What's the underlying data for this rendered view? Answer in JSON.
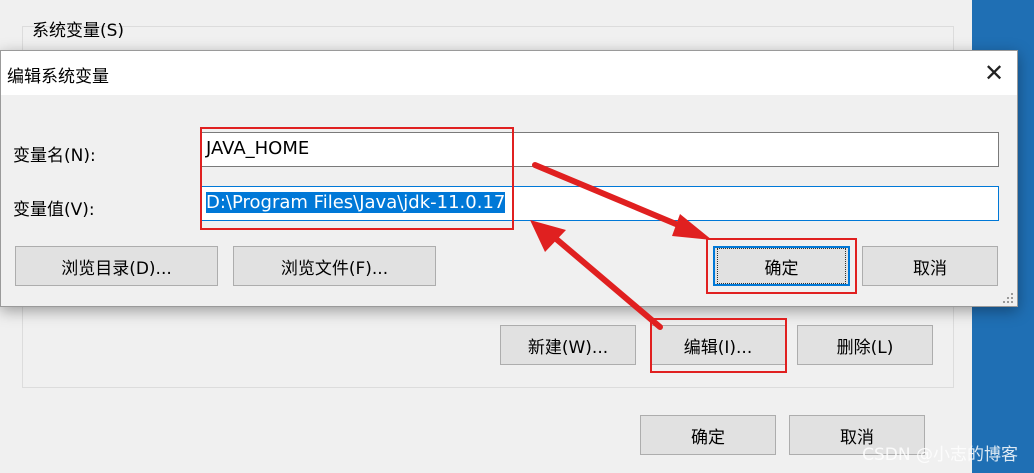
{
  "background_window": {
    "group_label": "系统变量(S)",
    "buttons": {
      "new": "新建(W)...",
      "edit": "编辑(I)...",
      "delete": "删除(L)"
    },
    "ok_label": "确定",
    "cancel_label": "取消"
  },
  "dialog": {
    "title": "编辑系统变量",
    "close_glyph": "✕",
    "name_label": "变量名(N):",
    "name_value": "JAVA_HOME",
    "value_label": "变量值(V):",
    "value_value": "D:\\Program Files\\Java\\jdk-11.0.17",
    "browse_dir_label": "浏览目录(D)...",
    "browse_file_label": "浏览文件(F)...",
    "ok_label": "确定",
    "cancel_label": "取消"
  },
  "annotation_color": "#e02020",
  "watermark": "CSDN @小志的博客"
}
